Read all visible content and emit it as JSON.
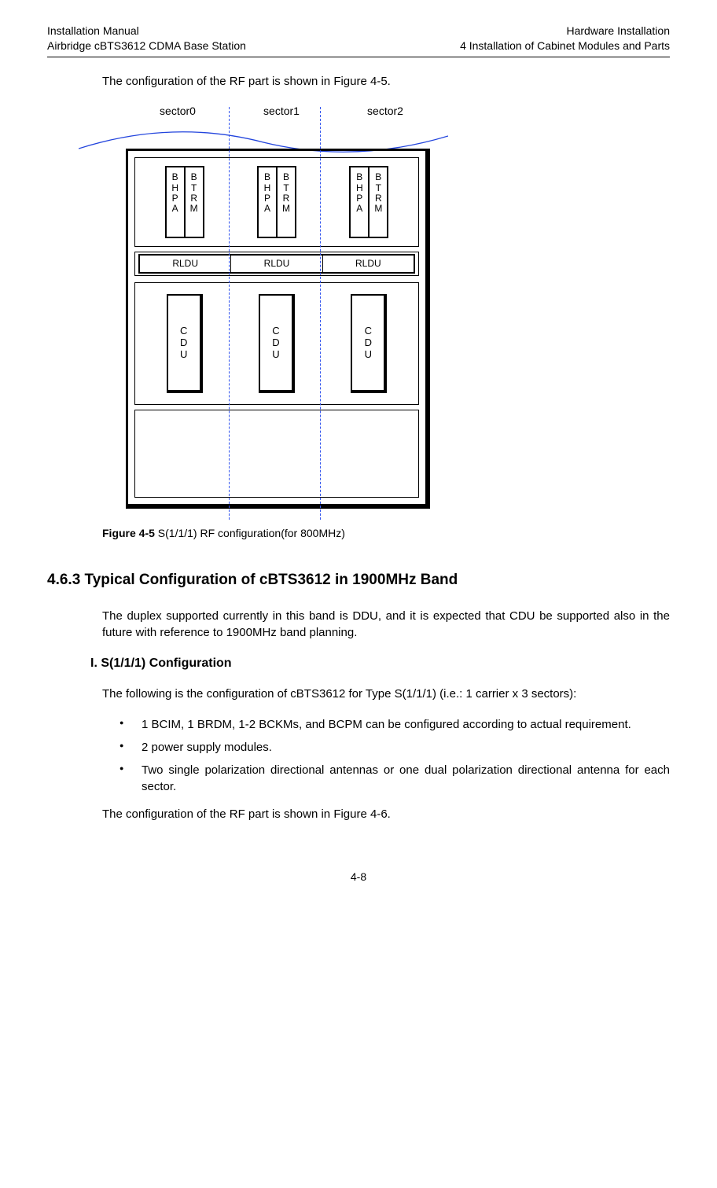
{
  "header": {
    "left1": "Installation Manual",
    "left2": "Airbridge cBTS3612 CDMA Base Station",
    "right1": "Hardware Installation",
    "right2": "4    Installation of Cabinet Modules and Parts"
  },
  "intro_line": "The configuration of the RF part is shown in Figure 4-5.",
  "sectors": [
    "sector0",
    "sector1",
    "sector2"
  ],
  "modules": {
    "bhpa": "B\nH\nP\nA",
    "btrm": "B\nT\nR\nM",
    "rldu": "RLDU",
    "cdu": "C\nD\nU"
  },
  "figure_caption_label": "Figure 4-5",
  "figure_caption_text": " S(1/1/1) RF configuration(for 800MHz)",
  "section_heading": "4.6.3  Typical Configuration of cBTS3612 in 1900MHz Band",
  "para1": "The duplex supported currently in this band is DDU, and it is expected that CDU be supported also in the future with reference to 1900MHz band planning.",
  "sub_heading": "I. S(1/1/1) Configuration",
  "para2": "The following is the configuration of cBTS3612 for Type S(1/1/1) (i.e.: 1 carrier x 3 sectors):",
  "bullets": [
    "1 BCIM, 1 BRDM, 1-2 BCKMs, and BCPM can be configured according to actual requirement.",
    "2 power supply modules.",
    "Two single polarization directional antennas or one dual polarization directional antenna for each sector."
  ],
  "para3": "The configuration of the RF part is shown in Figure 4-6.",
  "page_number": "4-8"
}
